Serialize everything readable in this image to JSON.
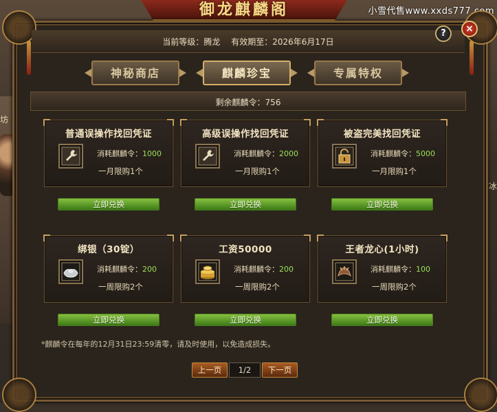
{
  "window": {
    "title": "御龙麒麟阁"
  },
  "watermark": "小雪代售www.xxds777.com",
  "scene": {
    "left_text": "坊",
    "right_text": "冰"
  },
  "header": {
    "level_label": "当前等级：",
    "level_value": "腾龙",
    "expiry_label": "有效期至：",
    "expiry_value": "2026年6月17日"
  },
  "controls": {
    "help": "?",
    "close": "×"
  },
  "tabs": [
    {
      "label": "神秘商店",
      "active": false
    },
    {
      "label": "麒麟珍宝",
      "active": true
    },
    {
      "label": "专属特权",
      "active": false
    }
  ],
  "remaining": "剩余麒麟令：756",
  "items": [
    {
      "title": "普通误操作找回凭证",
      "cost_label": "消耗麒麟令：",
      "cost": "1000",
      "limit": "一月限购1个",
      "icon": "wrench-icon",
      "button": "立即兑换"
    },
    {
      "title": "高级误操作找回凭证",
      "cost_label": "消耗麒麟令：",
      "cost": "2000",
      "limit": "一月限购1个",
      "icon": "wrench-icon",
      "button": "立即兑换"
    },
    {
      "title": "被盗完美找回凭证",
      "cost_label": "消耗麒麟令：",
      "cost": "5000",
      "limit": "一月限购1个",
      "icon": "lock-icon",
      "button": "立即兑换"
    },
    {
      "title": "绑银（30锭）",
      "cost_label": "消耗麒麟令：",
      "cost": "200",
      "limit": "一周限购2个",
      "icon": "silver-ingot-icon",
      "button": "立即兑换"
    },
    {
      "title": "工资50000",
      "cost_label": "消耗麒麟令：",
      "cost": "200",
      "limit": "一周限购2个",
      "icon": "gold-coins-icon",
      "button": "立即兑换"
    },
    {
      "title": "王者龙心(1小时)",
      "cost_label": "消耗麒麟令：",
      "cost": "100",
      "limit": "一周限购2个",
      "icon": "dragon-heart-icon",
      "button": "立即兑换"
    }
  ],
  "note": "*麒麟令在每年的12月31日23:59清零，请及时使用，以免造成损失。",
  "pagination": {
    "prev": "上一页",
    "page": "1/2",
    "next": "下一页"
  },
  "colors": {
    "accent_green": "#9ae05a",
    "button_green": "#5c9a28",
    "gold": "#c8943c"
  }
}
